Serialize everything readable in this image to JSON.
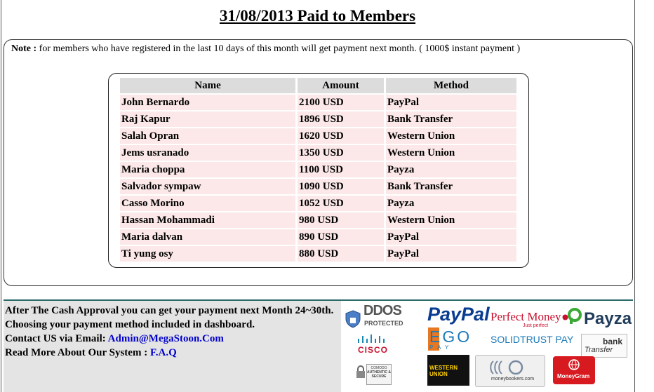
{
  "page": {
    "title": "31/08/2013 Paid to Members"
  },
  "note": {
    "label": "Note :",
    "text": " for members who have registered in the last 10 days of this month will get payment next month. ( 1000$ instant payment )"
  },
  "table": {
    "headers": [
      "Name",
      "Amount",
      "Method"
    ],
    "rows": [
      {
        "name": "John Bernardo",
        "amount": "2100 USD",
        "method": "PayPal"
      },
      {
        "name": "Raj Kapur",
        "amount": "1896 USD",
        "method": "Bank Transfer"
      },
      {
        "name": "Salah Opran",
        "amount": "1620 USD",
        "method": "Western Union"
      },
      {
        "name": "Jems usranado",
        "amount": "1350 USD",
        "method": "Western Union"
      },
      {
        "name": "Maria choppa",
        "amount": "1100 USD",
        "method": "Payza"
      },
      {
        "name": "Salvador sympaw",
        "amount": "1090 USD",
        "method": "Bank Transfer"
      },
      {
        "name": "Casso Morino",
        "amount": "1052 USD",
        "method": "Payza"
      },
      {
        "name": "Hassan Mohammadi",
        "amount": "980 USD",
        "method": "Western Union"
      },
      {
        "name": "Maria dalvan",
        "amount": "890 USD",
        "method": "PayPal"
      },
      {
        "name": "Ti yung osy",
        "amount": "880 USD",
        "method": "PayPal"
      }
    ]
  },
  "footer": {
    "line1": "After The Cash Approval you can get your payment next Month 24~30th.",
    "line2": "Choosing your payment method included in dashboard.",
    "contact_label": "Contact US via Email: ",
    "contact_email": "Admin@MegaStoon.Com",
    "readmore_label": "Read More About Our System : ",
    "readmore_link": "F.A.Q"
  },
  "logos": {
    "ddos": "DDOS",
    "ddos_sub": "PROTECTED",
    "cisco": "CISCO",
    "comodo": "COMODO",
    "comodo_sub": "AUTHENTIC & SECURE",
    "paypal": "PayPal",
    "perfect_money": "Perfect Money",
    "perfect_money_sub": "Just perfect",
    "payza": "Payza",
    "ego": "EGO",
    "ego_sub": "P A Y",
    "solidtrust": "SOLIDTRUST PAY",
    "bank_transfer_1": "bank",
    "bank_transfer_2": "Transfer",
    "western_union": "WESTERN UNION",
    "moneybookers": "moneybookers.com",
    "moneygram": "MoneyGram"
  },
  "colors": {
    "row_bg": "#fce8e8",
    "header_bg": "#dcdcdc",
    "footer_bg": "#e4e4e4",
    "link": "#0000cc",
    "paypal_blue": "#0a3d91",
    "perfect_money_red": "#c8102e",
    "payza_green": "#3aa935"
  }
}
